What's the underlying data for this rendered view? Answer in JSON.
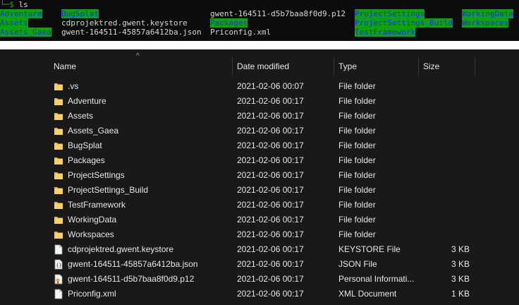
{
  "terminal": {
    "prompt_arc": "└─",
    "prompt_dollar": "$",
    "command": "ls",
    "columns": [
      [
        "Adventure",
        "Assets",
        "Assets_Gaea"
      ],
      [
        "BugSplat",
        "cdprojektred.gwent.keystore",
        "gwent-164511-45857a6412ba.json"
      ],
      [
        "gwent-164511-d5b7baa8f0d9.p12",
        "Packages",
        "Priconfig.xml"
      ],
      [
        "ProjectSettings",
        "ProjectSettings_Build",
        "TestFramework"
      ],
      [
        "WorkingData",
        "Workspaces",
        ""
      ]
    ]
  },
  "explorer": {
    "sort_indicator": "^",
    "headers": {
      "name": "Name",
      "date": "Date modified",
      "type": "Type",
      "size": "Size"
    },
    "rows": [
      {
        "name": ".vs",
        "date": "2021-02-06 00:07",
        "type": "File folder",
        "size": "",
        "icon": "folder-icon"
      },
      {
        "name": "Adventure",
        "date": "2021-02-06 00:17",
        "type": "File folder",
        "size": "",
        "icon": "folder-icon"
      },
      {
        "name": "Assets",
        "date": "2021-02-06 00:17",
        "type": "File folder",
        "size": "",
        "icon": "folder-icon"
      },
      {
        "name": "Assets_Gaea",
        "date": "2021-02-06 00:17",
        "type": "File folder",
        "size": "",
        "icon": "folder-icon"
      },
      {
        "name": "BugSplat",
        "date": "2021-02-06 00:17",
        "type": "File folder",
        "size": "",
        "icon": "folder-icon"
      },
      {
        "name": "Packages",
        "date": "2021-02-06 00:17",
        "type": "File folder",
        "size": "",
        "icon": "folder-icon"
      },
      {
        "name": "ProjectSettings",
        "date": "2021-02-06 00:17",
        "type": "File folder",
        "size": "",
        "icon": "folder-icon"
      },
      {
        "name": "ProjectSettings_Build",
        "date": "2021-02-06 00:17",
        "type": "File folder",
        "size": "",
        "icon": "folder-icon"
      },
      {
        "name": "TestFramework",
        "date": "2021-02-06 00:17",
        "type": "File folder",
        "size": "",
        "icon": "folder-icon"
      },
      {
        "name": "WorkingData",
        "date": "2021-02-06 00:17",
        "type": "File folder",
        "size": "",
        "icon": "folder-icon"
      },
      {
        "name": "Workspaces",
        "date": "2021-02-06 00:17",
        "type": "File folder",
        "size": "",
        "icon": "folder-icon"
      },
      {
        "name": "cdprojektred.gwent.keystore",
        "date": "2021-02-06 00:17",
        "type": "KEYSTORE File",
        "size": "3 KB",
        "icon": "file-icon"
      },
      {
        "name": "gwent-164511-45857a6412ba.json",
        "date": "2021-02-06 00:17",
        "type": "JSON File",
        "size": "3 KB",
        "icon": "json-file-icon"
      },
      {
        "name": "gwent-164511-d5b7baa8f0d9.p12",
        "date": "2021-02-06 00:17",
        "type": "Personal Informati...",
        "size": "3 KB",
        "icon": "certificate-file-icon"
      },
      {
        "name": "Priconfig.xml",
        "date": "2021-02-06 00:17",
        "type": "XML Document",
        "size": "1 KB",
        "icon": "file-icon"
      }
    ]
  },
  "colors": {
    "terminal_bg": "#0c0c0c",
    "dir_highlight": "#0fa10f",
    "dir_text": "#0d3ad8",
    "explorer_bg": "#191919",
    "folder": "#f2c94c"
  }
}
